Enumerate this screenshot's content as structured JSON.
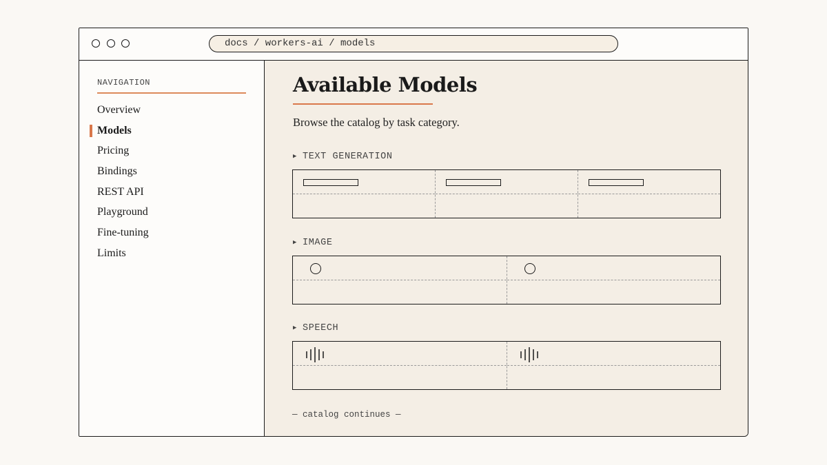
{
  "browser": {
    "url": "docs / workers-ai / models"
  },
  "sidebar": {
    "heading": "NAVIGATION",
    "items": [
      {
        "label": "Overview"
      },
      {
        "label": "Models",
        "active": true
      },
      {
        "label": "Pricing"
      },
      {
        "label": "Bindings"
      },
      {
        "label": "REST API"
      },
      {
        "label": "Playground"
      },
      {
        "label": "Fine-tuning"
      },
      {
        "label": "Limits"
      }
    ]
  },
  "main": {
    "title": "Available Models",
    "subtitle": "Browse the catalog by task category.",
    "sections": [
      {
        "label": "TEXT GENERATION",
        "cards": 3,
        "placeholder": "bar"
      },
      {
        "label": "IMAGE",
        "cards": 2,
        "placeholder": "circle"
      },
      {
        "label": "SPEECH",
        "cards": 2,
        "placeholder": "waveform"
      }
    ],
    "footer_note": "— catalog continues —"
  },
  "colors": {
    "accent": "#d9774a",
    "content_bg": "#f4eee5",
    "page_bg": "#faf8f4",
    "ink": "#1a1a1a"
  },
  "icons": [
    "window-dot-icon",
    "triangle-right-icon",
    "image-circle-icon",
    "waveform-icon"
  ]
}
